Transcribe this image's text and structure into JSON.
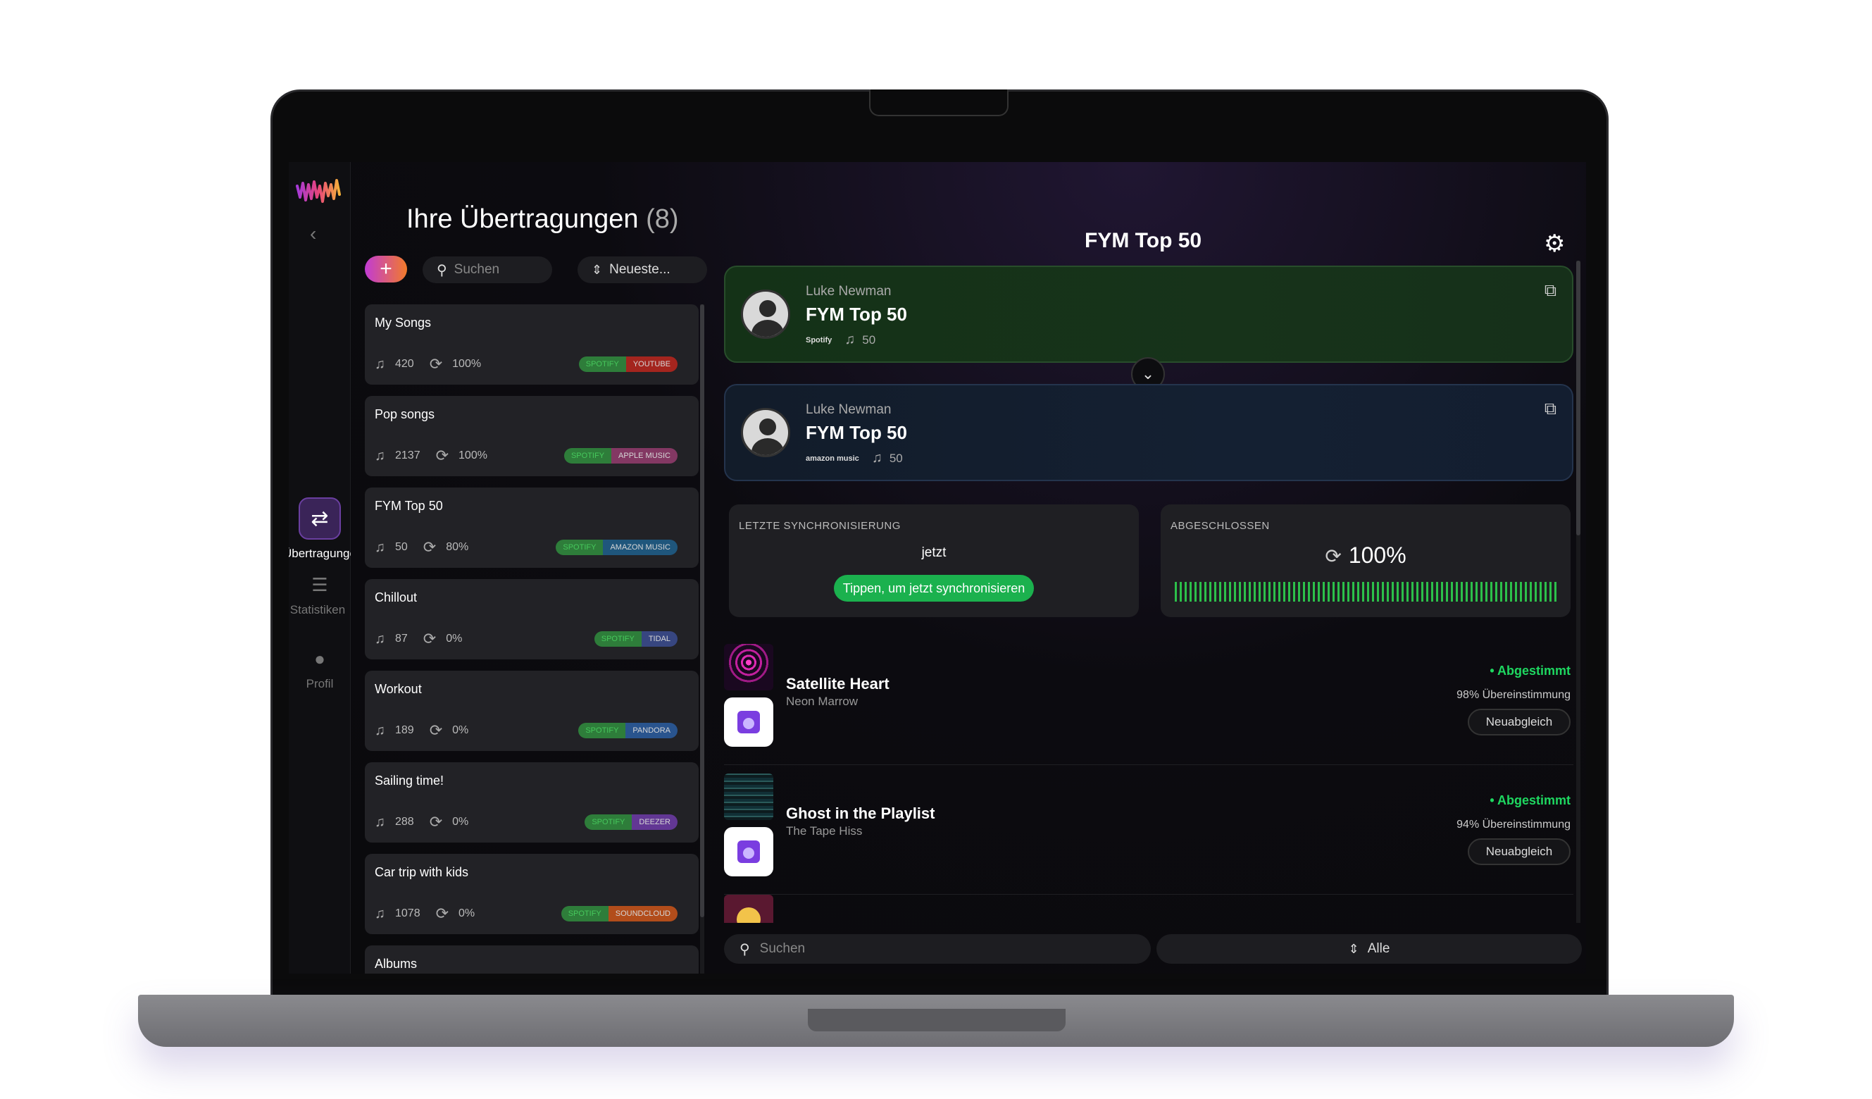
{
  "nav": {
    "items": [
      {
        "label": "Übertragungen",
        "icon": "transfer-icon",
        "active": true
      },
      {
        "label": "Statistiken",
        "icon": "stats-icon",
        "active": false
      },
      {
        "label": "Profil",
        "icon": "profile-icon",
        "active": false
      }
    ]
  },
  "transfers": {
    "title": "Ihre Übertragungen",
    "count": "(8)",
    "search_placeholder": "Suchen",
    "sort_label": "Neueste...",
    "items": [
      {
        "name": "My Songs",
        "tracks": "420",
        "sync": "100%",
        "from": "SPOTIFY",
        "to": "YOUTUBE",
        "from_color": "#2e7d3a",
        "to_color": "#b3261e"
      },
      {
        "name": "Pop songs",
        "tracks": "2137",
        "sync": "100%",
        "from": "SPOTIFY",
        "to": "APPLE MUSIC",
        "from_color": "#2e7d3a",
        "to_color": "#8e3b6a"
      },
      {
        "name": "FYM Top 50",
        "tracks": "50",
        "sync": "80%",
        "from": "SPOTIFY",
        "to": "AMAZON MUSIC",
        "from_color": "#2e7d3a",
        "to_color": "#1f5c86"
      },
      {
        "name": "Chillout",
        "tracks": "87",
        "sync": "0%",
        "from": "SPOTIFY",
        "to": "TIDAL",
        "from_color": "#2e7d3a",
        "to_color": "#3a4a8a"
      },
      {
        "name": "Workout",
        "tracks": "189",
        "sync": "0%",
        "from": "SPOTIFY",
        "to": "PANDORA",
        "from_color": "#2e7d3a",
        "to_color": "#2a5a9a"
      },
      {
        "name": "Sailing time!",
        "tracks": "288",
        "sync": "0%",
        "from": "SPOTIFY",
        "to": "DEEZER",
        "from_color": "#2e7d3a",
        "to_color": "#6a3aa0"
      },
      {
        "name": "Car trip with kids",
        "tracks": "1078",
        "sync": "0%",
        "from": "SPOTIFY",
        "to": "SOUNDCLOUD",
        "from_color": "#2e7d3a",
        "to_color": "#c2521a"
      },
      {
        "name": "Albums",
        "tracks": "",
        "sync": "",
        "from": "",
        "to": "",
        "from_color": "#2e7d3a",
        "to_color": "#555555"
      }
    ]
  },
  "detail": {
    "title": "FYM Top 50",
    "source": {
      "owner": "Luke Newman",
      "name": "FYM Top 50",
      "service": "Spotify",
      "tracks": "50"
    },
    "destination": {
      "owner": "Luke Newman",
      "name": "FYM Top 50",
      "service": "amazon music",
      "tracks": "50"
    },
    "last_sync": {
      "label": "LETZTE SYNCHRONISIERUNG",
      "value": "jetzt",
      "button": "Tippen, um jetzt synchronisieren"
    },
    "completed": {
      "label": "ABGESCHLOSSEN",
      "value": "100%",
      "progress": 1.0
    },
    "tracks": [
      {
        "title": "Satellite Heart",
        "artist": "Neon Marrow",
        "status": "• Abgestimmt",
        "match": "98% Übereinstimmung",
        "button": "Neuabgleich"
      },
      {
        "title": "Ghost in the Playlist",
        "artist": "The Tape Hiss",
        "status": "• Abgestimmt",
        "match": "94% Übereinstimmung",
        "button": "Neuabgleich"
      }
    ],
    "search_placeholder": "Suchen",
    "filter_label": "Alle"
  },
  "colors": {
    "accent": "#1bb14e",
    "brand_gradient_start": "#c13bd4",
    "brand_gradient_end": "#f27b2a"
  }
}
